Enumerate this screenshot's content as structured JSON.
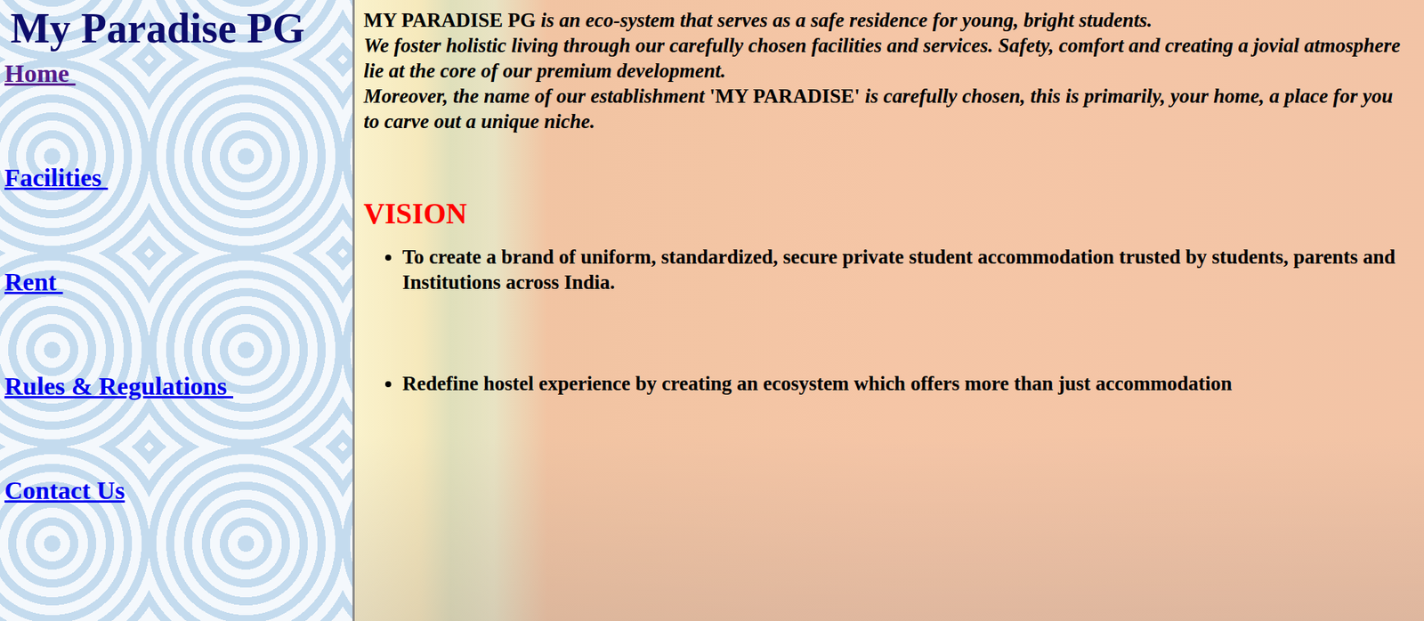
{
  "sidebar": {
    "title": "My Paradise PG",
    "items": [
      {
        "label": "Home ",
        "visited": true
      },
      {
        "label": "Facilities ",
        "visited": false
      },
      {
        "label": "Rent ",
        "visited": false
      },
      {
        "label": "Rules & Regulations ",
        "visited": false
      },
      {
        "label": "Contact Us",
        "visited": false
      }
    ]
  },
  "intro": [
    [
      {
        "text": "MY PARADISE PG",
        "italic": false
      },
      {
        "text": " is an eco-system that serves as a safe residence for young, bright students.",
        "italic": true
      }
    ],
    [
      {
        "text": "We foster holistic living through our carefully chosen facilities and services. Safety, comfort and creating a jovial atmosphere lie at the core of our premium development.",
        "italic": true
      }
    ],
    [
      {
        "text": "Moreover, the name of our establishment ",
        "italic": true
      },
      {
        "text": "'MY PARADISE'",
        "italic": false
      },
      {
        "text": " is carefully chosen, this is primarily, your home, a place for you to carve out a unique niche.",
        "italic": true
      }
    ]
  ],
  "vision": {
    "heading": "VISION",
    "items": [
      "To create a brand of uniform, standardized, secure private student accommodation trusted by students, parents and Institutions across India.",
      "Redefine hostel experience by creating an ecosystem which offers more than just accommodation"
    ]
  }
}
